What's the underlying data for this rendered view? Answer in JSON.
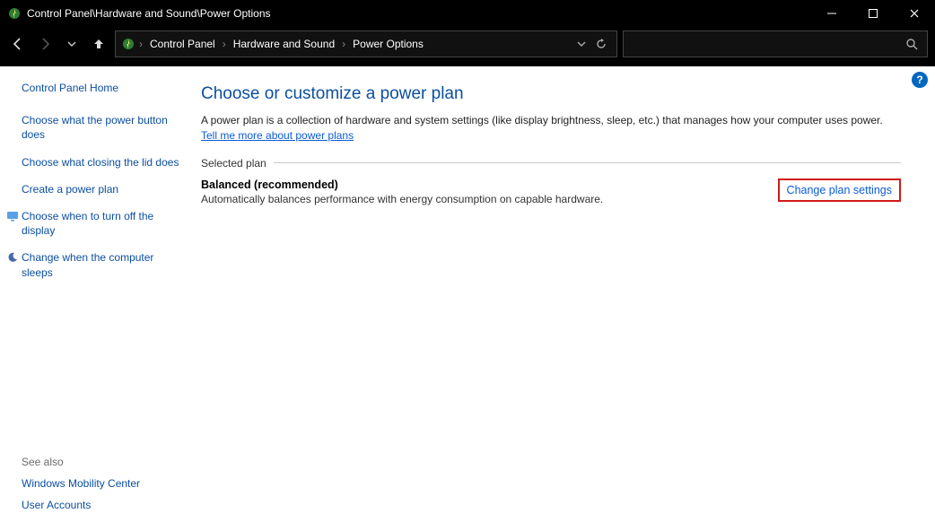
{
  "titlebar": {
    "title": "Control Panel\\Hardware and Sound\\Power Options"
  },
  "breadcrumbs": {
    "items": [
      "Control Panel",
      "Hardware and Sound",
      "Power Options"
    ]
  },
  "sidebar": {
    "home": "Control Panel Home",
    "links": [
      "Choose what the power button does",
      "Choose what closing the lid does",
      "Create a power plan",
      "Choose when to turn off the display",
      "Change when the computer sleeps"
    ],
    "see_also_heading": "See also",
    "see_also": [
      "Windows Mobility Center",
      "User Accounts"
    ]
  },
  "main": {
    "heading": "Choose or customize a power plan",
    "description_pre": "A power plan is a collection of hardware and system settings (like display brightness, sleep, etc.) that manages how your computer uses power. ",
    "description_link": "Tell me more about power plans",
    "section_label": "Selected plan",
    "plan_name": "Balanced (recommended)",
    "plan_desc": "Automatically balances performance with energy consumption on capable hardware.",
    "change_link": "Change plan settings"
  },
  "help_tooltip": "?"
}
